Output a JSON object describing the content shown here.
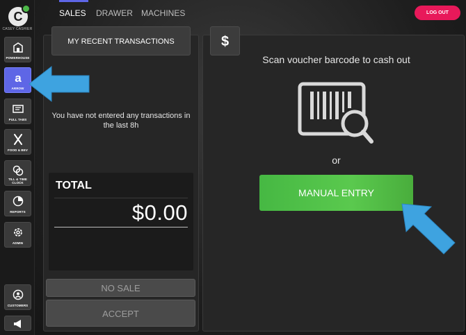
{
  "user": {
    "initial": "C",
    "name": "CASEY CASHIER"
  },
  "sidebar": {
    "items": [
      {
        "label": "POWERHOUSE"
      },
      {
        "label": "ARROW"
      },
      {
        "label": "PULL TABS"
      },
      {
        "label": "FOOD & BEV"
      },
      {
        "label": "TILL & TIME CLOCK"
      },
      {
        "label": "REPORTS"
      },
      {
        "label": "ADMIN"
      },
      {
        "label": "CUSTOMERS"
      }
    ]
  },
  "tabs": [
    {
      "label": "SALES"
    },
    {
      "label": "DRAWER"
    },
    {
      "label": "MACHINES"
    }
  ],
  "header": {
    "logout_label": "LOG OUT"
  },
  "left": {
    "recent_label": "MY RECENT TRANSACTIONS",
    "empty_message": "You have not entered any transactions in the last 8h",
    "total_label": "TOTAL",
    "total_amount": "$0.00",
    "no_sale_label": "NO SALE",
    "accept_label": "ACCEPT"
  },
  "right": {
    "dollar_label": "$",
    "scan_title": "Scan voucher barcode to cash out",
    "or_label": "or",
    "manual_entry_label": "MANUAL ENTRY"
  },
  "colors": {
    "accent": "#5e66e6",
    "logout": "#e8195a",
    "manual_entry": "#4cb848",
    "annotation_arrow": "#3ea3e0"
  }
}
